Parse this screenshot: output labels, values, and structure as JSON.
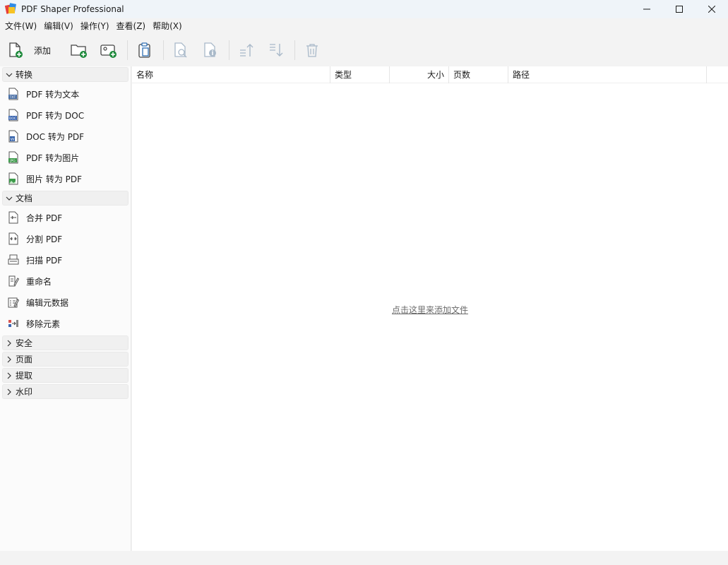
{
  "window": {
    "title": "PDF Shaper Professional"
  },
  "menu": [
    "文件(W)",
    "编辑(V)",
    "操作(Y)",
    "查看(Z)",
    "帮助(X)"
  ],
  "toolbar": {
    "add_label": "添加"
  },
  "sidebar": {
    "groups": [
      {
        "label": "转换",
        "expanded": true,
        "items": [
          {
            "label": "PDF 转为文本",
            "icon": "txt-file-icon"
          },
          {
            "label": "PDF 转为 DOC",
            "icon": "doc-file-icon"
          },
          {
            "label": "DOC 转为 PDF",
            "icon": "word-file-icon"
          },
          {
            "label": "PDF 转为图片",
            "icon": "jpg-file-icon"
          },
          {
            "label": "图片 转为 PDF",
            "icon": "image-file-icon"
          }
        ]
      },
      {
        "label": "文档",
        "expanded": true,
        "items": [
          {
            "label": "合并 PDF",
            "icon": "merge-icon"
          },
          {
            "label": "分割 PDF",
            "icon": "split-icon"
          },
          {
            "label": "扫描 PDF",
            "icon": "scanner-icon"
          },
          {
            "label": "重命名",
            "icon": "rename-icon"
          },
          {
            "label": "编辑元数据",
            "icon": "metadata-icon"
          },
          {
            "label": "移除元素",
            "icon": "remove-elements-icon"
          }
        ]
      },
      {
        "label": "安全",
        "expanded": false
      },
      {
        "label": "页面",
        "expanded": false
      },
      {
        "label": "提取",
        "expanded": false
      },
      {
        "label": "水印",
        "expanded": false
      }
    ]
  },
  "file_list": {
    "columns": [
      "名称",
      "类型",
      "大小",
      "页数",
      "路径"
    ],
    "empty_hint": "点击这里来添加文件"
  },
  "colors": {
    "accent_green": "#1e8a3c",
    "disabled_icon": "#a9b9c9"
  }
}
